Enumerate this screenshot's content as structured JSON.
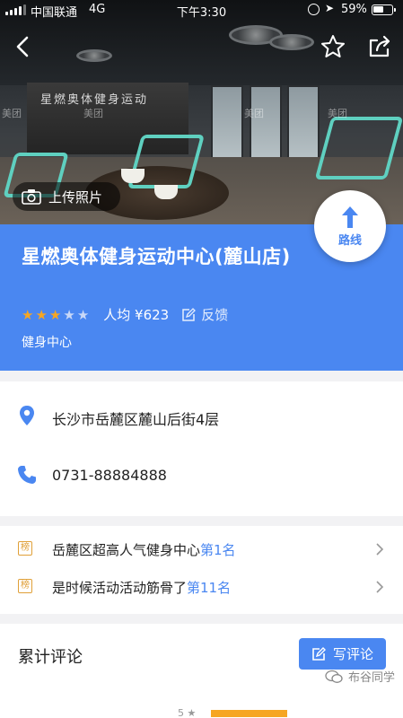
{
  "status_bar": {
    "carrier": "中国联通",
    "network": "4G",
    "time": "下午3:30",
    "battery": "59%",
    "battery_level": 0.59
  },
  "hero": {
    "upload_label": "上传照片",
    "wall_sign": "星燃奥体健身运动",
    "watermark_text": "美团"
  },
  "place": {
    "title": "星燃奥体健身运动中心(麓山店)",
    "rating_stars": 3,
    "rating_max": 5,
    "avg_price": "人均 ¥623",
    "feedback_label": "反馈",
    "category": "健身中心",
    "route_label": "路线"
  },
  "contact": {
    "address": "长沙市岳麓区麓山后街4层",
    "phone": "0731-88884888"
  },
  "rankings": [
    {
      "badge": "榜",
      "text": "岳麓区超高人气健身中心",
      "rank": "第1名"
    },
    {
      "badge": "榜",
      "text": "是时候活动活动筋骨了",
      "rank": "第11名"
    }
  ],
  "reviews": {
    "title": "累计评论",
    "write_label": "写评论",
    "score_label": "5"
  },
  "watermark": {
    "text": "布谷同学"
  },
  "colors": {
    "accent": "#4a87f1",
    "star": "#f6a623",
    "rank_badge": "#e0a038"
  }
}
